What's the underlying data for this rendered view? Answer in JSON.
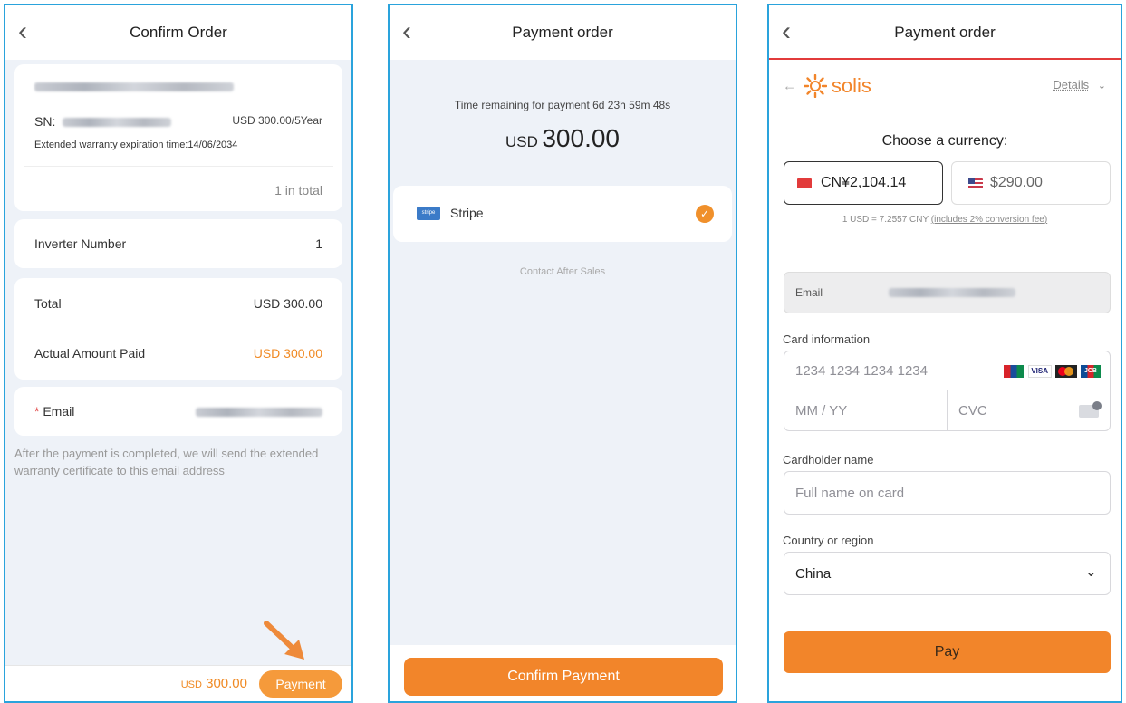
{
  "panel1": {
    "title": "Confirm Order",
    "sn_label": "SN:",
    "price": "USD 300.00/5Year",
    "expiration": "Extended warranty expiration time:14/06/2034",
    "count": "1 in total",
    "inverter_label": "Inverter Number",
    "inverter_value": "1",
    "total_label": "Total",
    "total_value": "USD 300.00",
    "actual_label": "Actual Amount Paid",
    "actual_value": "USD 300.00",
    "email_required": "*",
    "email_label": "Email",
    "note": "After the payment is completed, we will send the extended warranty certificate to this email address",
    "bottom_currency": "USD",
    "bottom_amount": "300.00",
    "payment_button": "Payment"
  },
  "panel2": {
    "title": "Payment order",
    "time_remaining": "Time remaining for payment 6d 23h 59m 48s",
    "currency": "USD",
    "amount": "300.00",
    "method_logo": "stripe",
    "method": "Stripe",
    "contact": "Contact After Sales",
    "confirm_button": "Confirm Payment"
  },
  "panel3": {
    "title": "Payment order",
    "brand": "solis",
    "details": "Details",
    "choose_currency": "Choose a currency:",
    "cny": "CN¥2,104.14",
    "usd": "$290.00",
    "rate": "1 USD = 7.2557 CNY",
    "fee": "(includes 2% conversion fee)",
    "email_label": "Email",
    "card_label": "Card information",
    "card_placeholder": "1234 1234 1234 1234",
    "visa": "VISA",
    "jcb": "JCB",
    "expiry_placeholder": "MM / YY",
    "cvc_placeholder": "CVC",
    "cardholder_label": "Cardholder name",
    "cardholder_placeholder": "Full name on card",
    "country_label": "Country or region",
    "country_value": "China",
    "pay_button": "Pay"
  },
  "colors": {
    "accent_orange": "#f2852a",
    "frame_blue": "#2aa3dc",
    "header_red": "#e23b3b"
  }
}
